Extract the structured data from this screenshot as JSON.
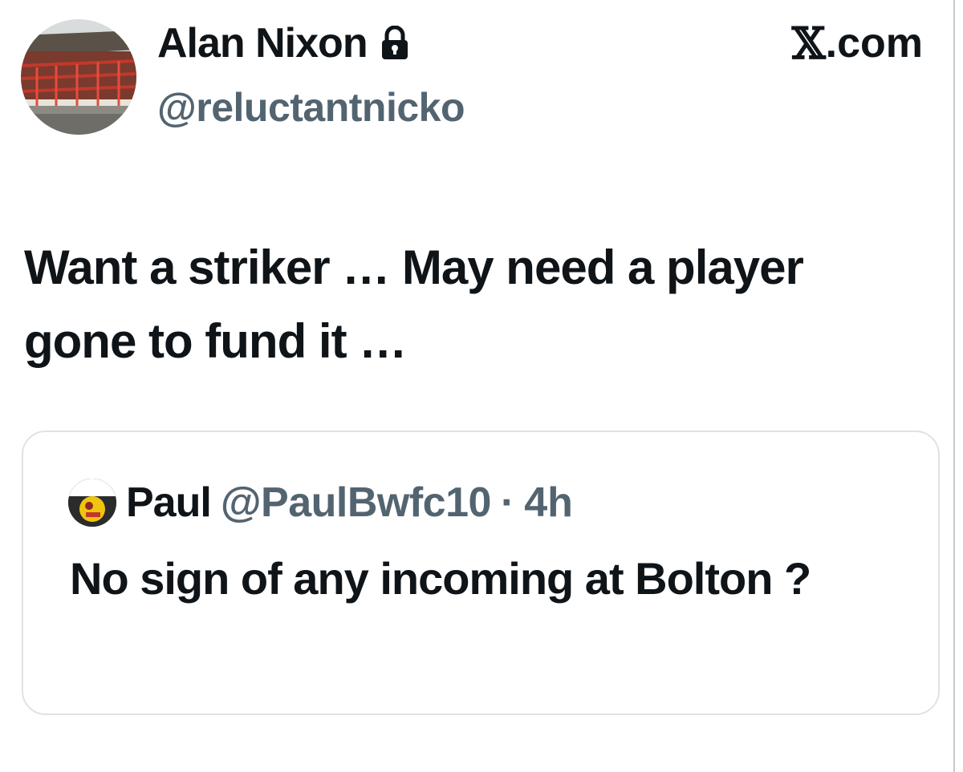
{
  "author": {
    "display_name": "Alan Nixon",
    "handle": "@reluctantnicko",
    "lock_icon": "lock-icon",
    "avatar": "stadium-stand-avatar"
  },
  "brand": {
    "label": "X.com",
    "x_glyph": "𝕏",
    "suffix": ".com"
  },
  "tweet": {
    "text": "Want a striker … May need a player gone to fund it …"
  },
  "quote": {
    "author_name": "Paul",
    "author_handle": "@PaulBwfc10",
    "separator": "·",
    "time": "4h",
    "text": "No sign of any incoming at Bolton ?"
  },
  "colors": {
    "text_primary": "#0f1419",
    "text_secondary": "#536471",
    "card_border": "#dfe3e6"
  }
}
